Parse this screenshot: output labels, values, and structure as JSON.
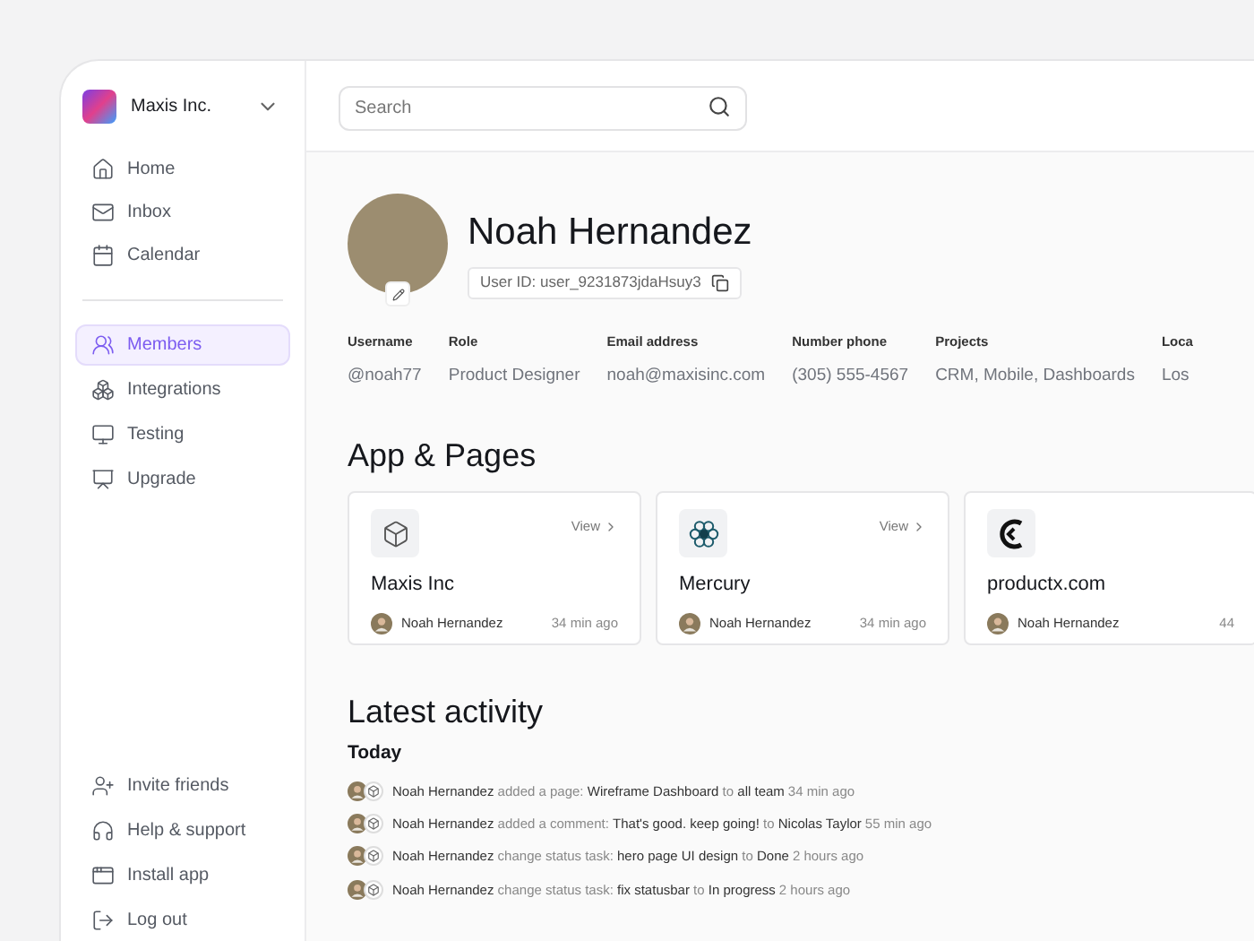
{
  "workspace": {
    "name": "Maxis Inc."
  },
  "sidebar": {
    "items": [
      {
        "label": "Home",
        "selected": false
      },
      {
        "label": "Inbox",
        "selected": false
      },
      {
        "label": "Calendar",
        "selected": false
      }
    ],
    "items_2": [
      {
        "label": "Members",
        "selected": true
      },
      {
        "label": "Integrations",
        "selected": false
      },
      {
        "label": "Testing",
        "selected": false
      },
      {
        "label": "Upgrade",
        "selected": false
      }
    ],
    "footer_items": [
      {
        "label": "Invite friends"
      },
      {
        "label": "Help & support"
      },
      {
        "label": "Install app"
      },
      {
        "label": "Log out"
      }
    ]
  },
  "search": {
    "placeholder": "Search"
  },
  "profile": {
    "name": "Noah Hernandez",
    "user_id": "User ID: user_9231873jdaHsuy3",
    "fields": [
      {
        "label": "Username",
        "value": "@noah77"
      },
      {
        "label": "Role",
        "value": "Product Designer"
      },
      {
        "label": "Email address",
        "value": "noah@maxisinc.com"
      },
      {
        "label": "Number phone",
        "value": "(305) 555-4567"
      },
      {
        "label": "Projects",
        "value": "CRM, Mobile, Dashboards"
      },
      {
        "label": "Loca",
        "value": "Los"
      }
    ]
  },
  "apps": {
    "title": "App & Pages",
    "cards": [
      {
        "name": "Maxis Inc",
        "link": "View",
        "user": "Noah Hernandez",
        "time": "34 min ago"
      },
      {
        "name": "Mercury",
        "link": "View",
        "user": "Noah Hernandez",
        "time": "34 min ago"
      },
      {
        "name": "productx.com",
        "user": "Noah Hernandez",
        "time": "44"
      }
    ]
  },
  "activity": {
    "title": "Latest activity",
    "group": "Today",
    "items": [
      {
        "text": "**Noah Hernandez** added a page: **Wireframe Dashboard** to **all team**",
        "time": "34 min ago"
      },
      {
        "text": "**Noah Hernandez** added a comment: **That's good. keep going!** to **Nicolas Taylor**",
        "time": "55 min ago"
      },
      {
        "text": "**Noah Hernandez** change status task: **hero page UI design** to **Done**",
        "time": "2 hours ago"
      },
      {
        "text": "**Noah Hernandez** change status task: **fix statusbar** to **In progress**",
        "time": "2 hours ago"
      }
    ]
  }
}
